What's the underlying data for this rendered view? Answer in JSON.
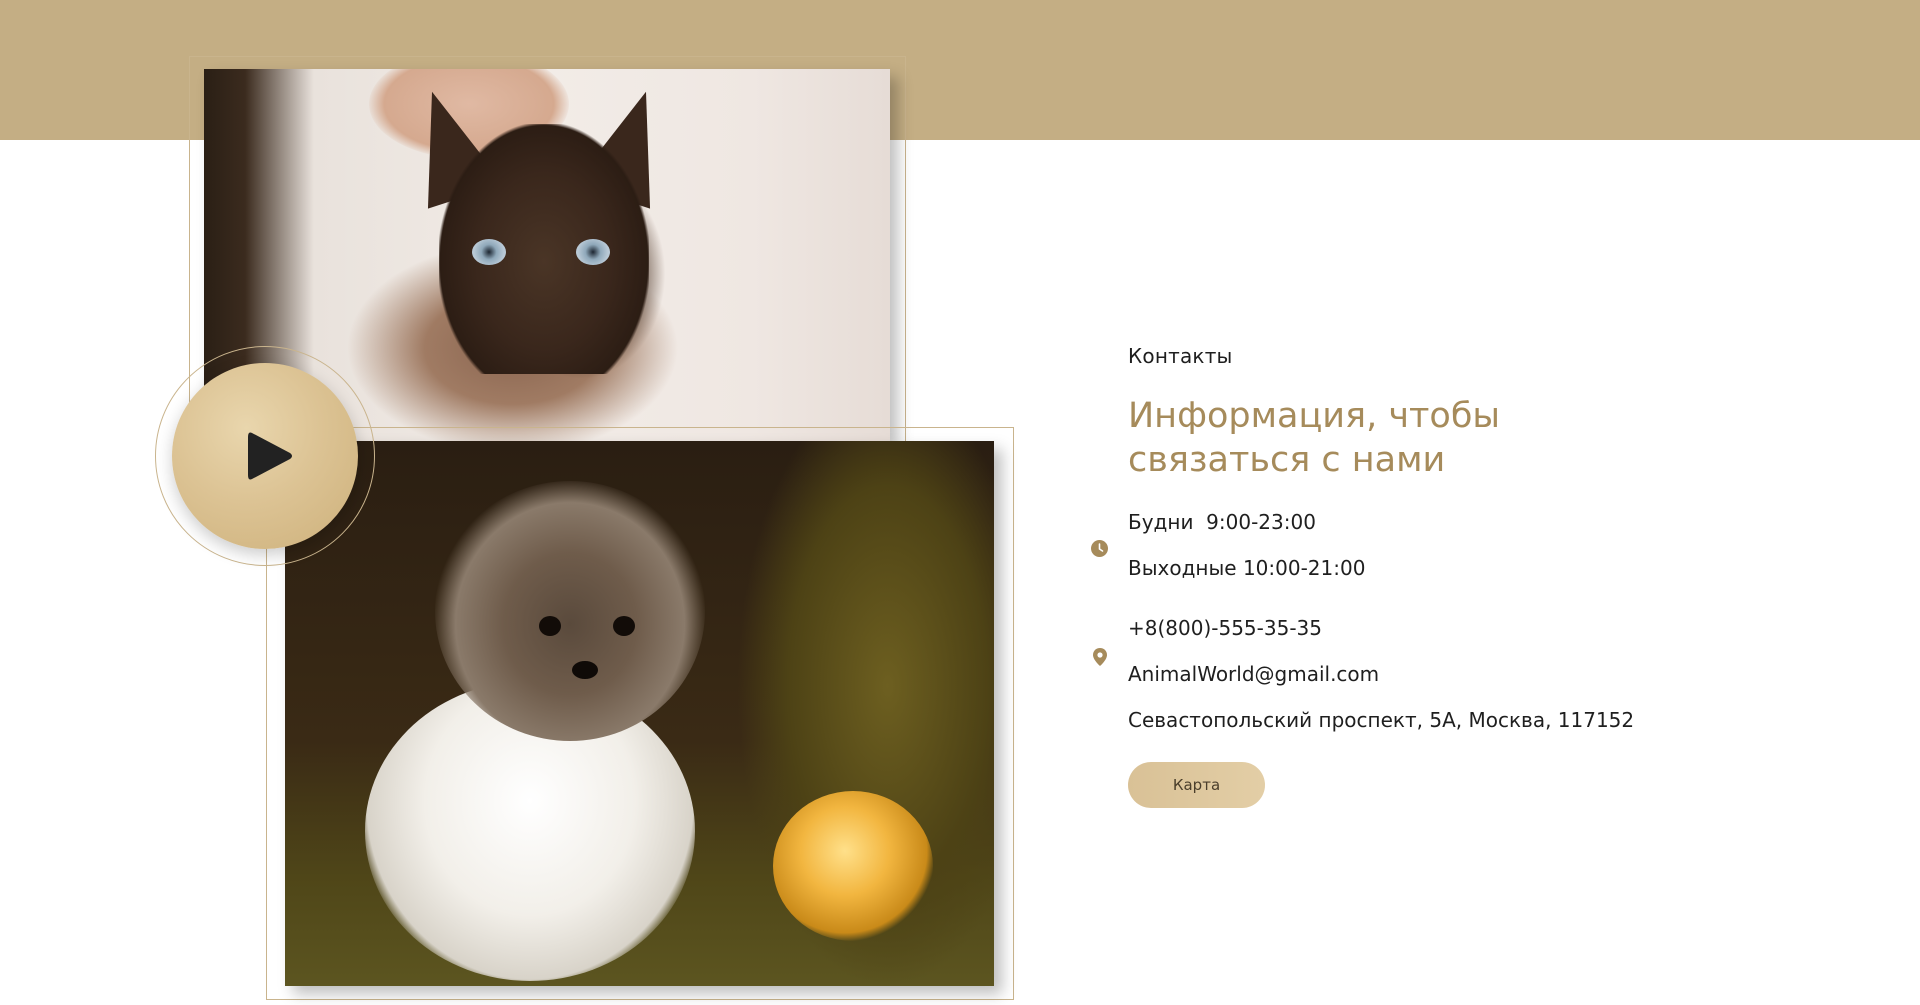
{
  "contacts": {
    "label": "Контакты",
    "title": "Информация, чтобы связаться с нами",
    "hours_weekdays": "Будни  9:00-23:00",
    "hours_weekend": "Выходные 10:00-21:00",
    "phone": "+8(800)-555-35-35",
    "email": "AnimalWorld@gmail.com",
    "address": "Севастопольский проспект, 5А, Москва, 117152",
    "map_button": "Карта"
  },
  "colors": {
    "accent": "#c4ae84",
    "title": "#a68b5b",
    "button": "#dcc394",
    "text": "#1f1f1f"
  },
  "icons": [
    "play-icon",
    "clock-icon",
    "location-pin-icon"
  ]
}
